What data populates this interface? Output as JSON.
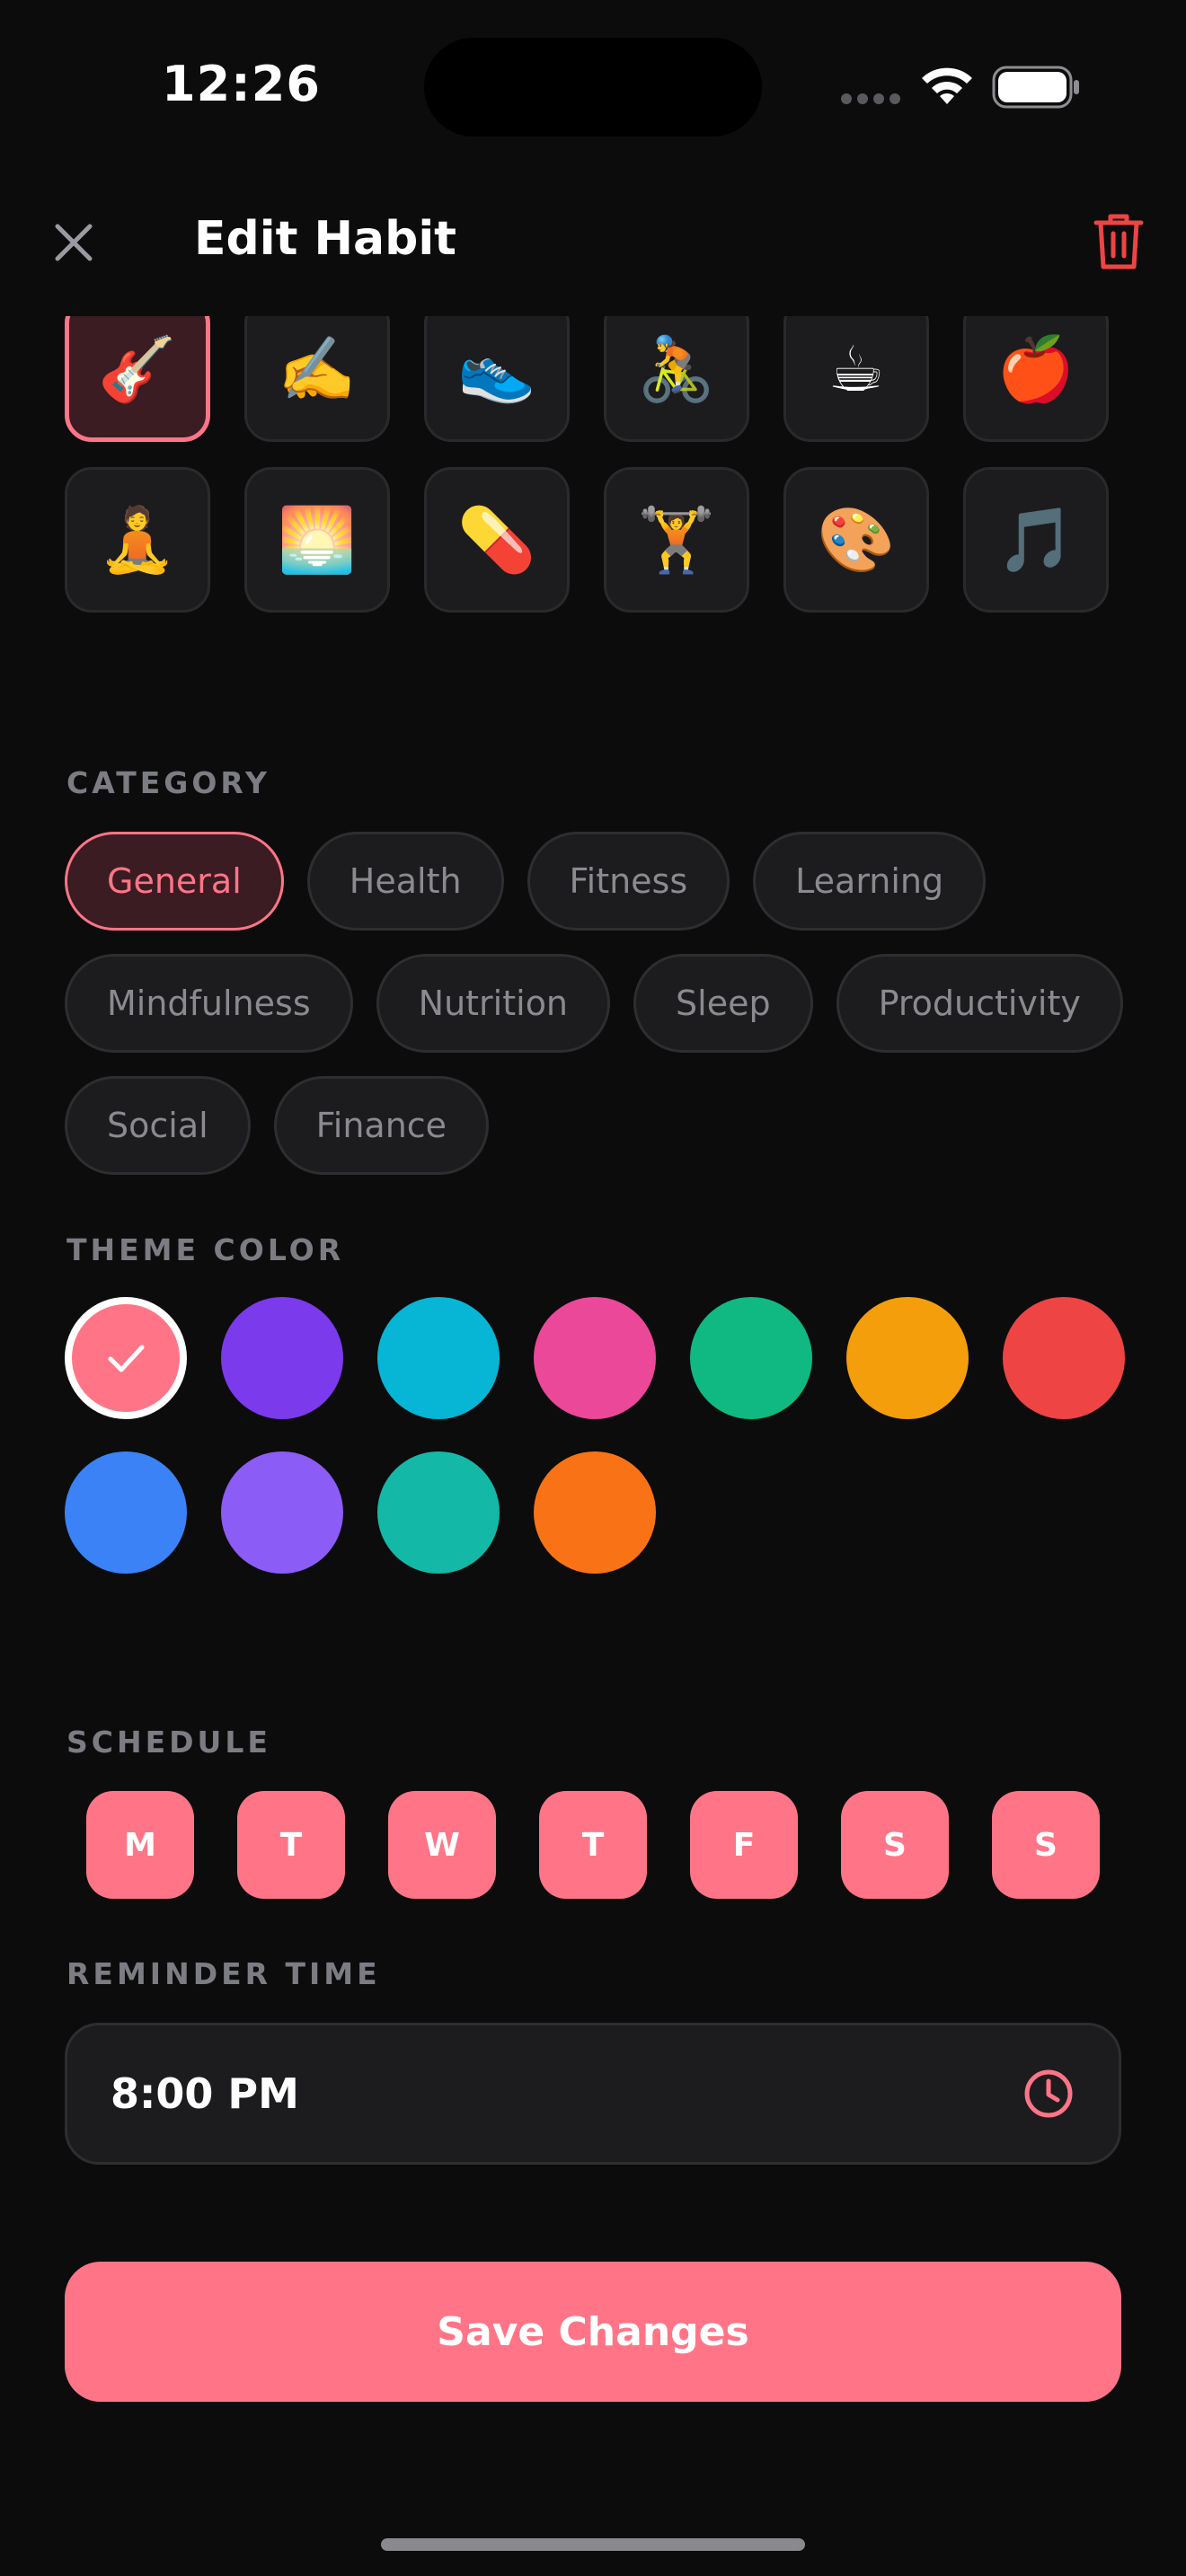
{
  "status_bar": {
    "time": "12:26"
  },
  "header": {
    "title": "Edit Habit"
  },
  "emoji_grid": {
    "rows": [
      [
        {
          "emoji": "🎸",
          "selected": true
        },
        {
          "emoji": "✍️",
          "selected": false
        },
        {
          "emoji": "👟",
          "selected": false
        },
        {
          "emoji": "🚴",
          "selected": false
        },
        {
          "emoji": "☕",
          "selected": false
        },
        {
          "emoji": "🍎",
          "selected": false
        }
      ],
      [
        {
          "emoji": "🧘",
          "selected": false
        },
        {
          "emoji": "🌅",
          "selected": false
        },
        {
          "emoji": "💊",
          "selected": false
        },
        {
          "emoji": "🏋️",
          "selected": false
        },
        {
          "emoji": "🎨",
          "selected": false
        },
        {
          "emoji": "🎵",
          "selected": false
        }
      ]
    ]
  },
  "category": {
    "label": "CATEGORY",
    "selected": "General",
    "items": [
      "General",
      "Health",
      "Fitness",
      "Learning",
      "Mindfulness",
      "Nutrition",
      "Sleep",
      "Productivity",
      "Social",
      "Finance"
    ]
  },
  "theme_color": {
    "label": "THEME COLOR",
    "selected_index": 0,
    "colors": [
      "#ff7587",
      "#7c3aed",
      "#06b6d4",
      "#ec4899",
      "#10b981",
      "#f59e0b",
      "#ef4444",
      "#3b82f6",
      "#8b5cf6",
      "#14b8a6",
      "#f97316"
    ]
  },
  "schedule": {
    "label": "SCHEDULE",
    "days": [
      "M",
      "T",
      "W",
      "T",
      "F",
      "S",
      "S"
    ]
  },
  "reminder": {
    "label": "REMINDER TIME",
    "value": "8:00 PM"
  },
  "save_label": "Save Changes",
  "accent_color": "#ff7587",
  "danger_color": "#ef4444"
}
